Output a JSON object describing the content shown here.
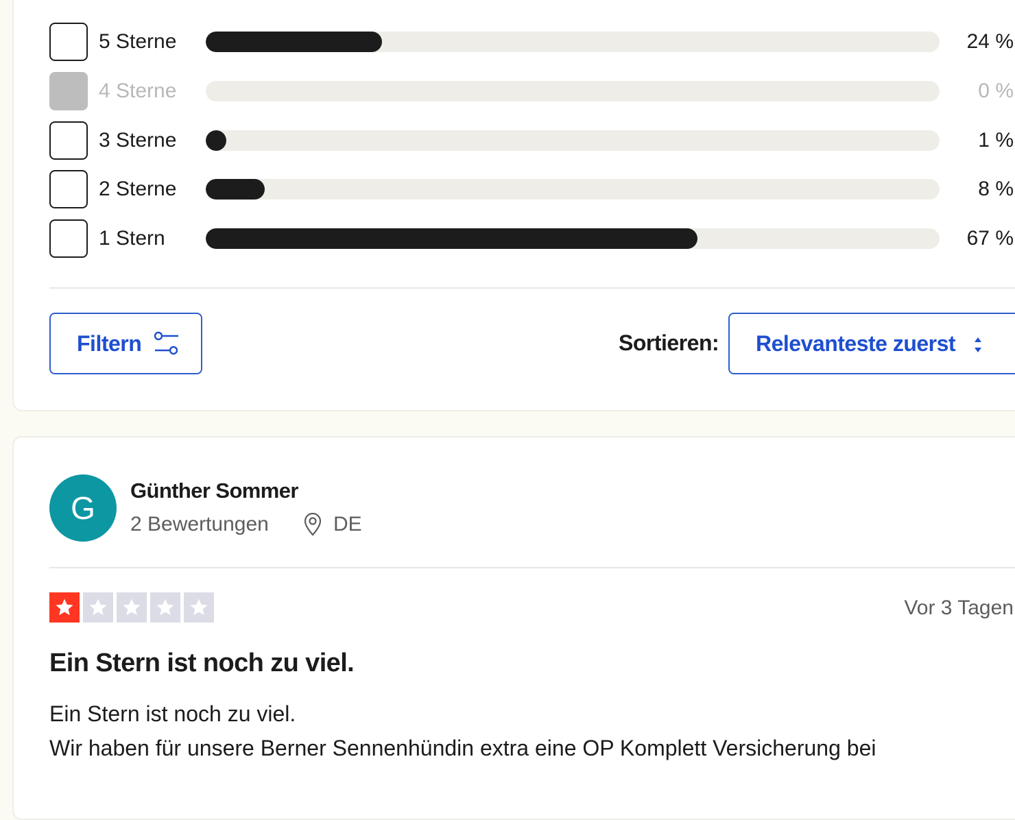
{
  "rating_distribution": [
    {
      "label": "5 Sterne",
      "percent_text": "24 %",
      "percent": 24,
      "disabled": false
    },
    {
      "label": "4 Sterne",
      "percent_text": "0 %",
      "percent": 0,
      "disabled": true
    },
    {
      "label": "3 Sterne",
      "percent_text": "1 %",
      "percent": 1,
      "disabled": false
    },
    {
      "label": "2 Sterne",
      "percent_text": "8 %",
      "percent": 8,
      "disabled": false
    },
    {
      "label": "1 Stern",
      "percent_text": "67 %",
      "percent": 67,
      "disabled": false
    }
  ],
  "toolbar": {
    "filter_label": "Filtern",
    "sort_label": "Sortieren:",
    "sort_value": "Relevanteste zuerst"
  },
  "review": {
    "avatar_initial": "G",
    "reviewer_name": "Günther Sommer",
    "review_count": "2 Bewertungen",
    "location": "DE",
    "rating": 1,
    "date": "Vor 3 Tagen",
    "title": "Ein Stern ist noch zu viel.",
    "body_lines": [
      "Ein Stern ist noch zu viel.",
      "Wir haben für unsere Berner Sennenhündin extra eine OP Komplett Versicherung bei"
    ]
  },
  "colors": {
    "accent": "#1e4fd0",
    "star_active": "#ff3722",
    "star_inactive": "#dcdce6",
    "avatar": "#0d97a3"
  }
}
